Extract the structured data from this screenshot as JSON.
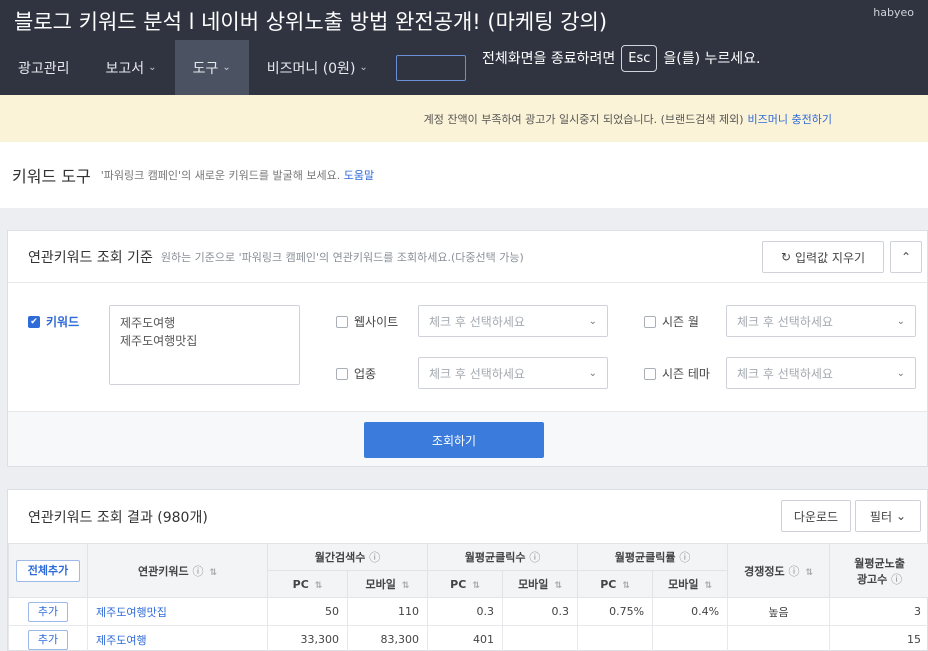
{
  "video_overlay": {
    "title": "블로그 키워드 분석 l 네이버 상위노출 방법 완전공개! (마케팅 강의)",
    "channel": "habyeo",
    "fullscreen_hint_before": "전체화면을 종료하려면",
    "fullscreen_hint_key": "Esc",
    "fullscreen_hint_after": "을(를) 누르세요."
  },
  "nav": {
    "items": [
      {
        "label": "광고관리",
        "dropdown": false,
        "active": false
      },
      {
        "label": "보고서",
        "dropdown": true,
        "active": false
      },
      {
        "label": "도구",
        "dropdown": true,
        "active": true
      },
      {
        "label": "비즈머니 (0원)",
        "dropdown": true,
        "active": false
      }
    ]
  },
  "banner": {
    "text": "계정 잔액이 부족하여 광고가 일시중지 되었습니다. (브랜드검색 제외)",
    "link": "비즈머니 충전하기"
  },
  "page_header": {
    "title": "키워드 도구",
    "desc": "'파워링크 캠페인'의 새로운 키워드를 발굴해 보세요.",
    "help": "도움말"
  },
  "criteria": {
    "title": "연관키워드 조회 기준",
    "desc": "원하는 기준으로 '파워링크 캠페인'의 연관키워드를 조회하세요.(다중선택 가능)",
    "reset_label": "입력값 지우기",
    "keyword_label": "키워드",
    "keyword_lines": [
      "제주도여행",
      "제주도여행맛집"
    ],
    "website_label": "웹사이트",
    "industry_label": "업종",
    "season_month_label": "시즌 월",
    "season_theme_label": "시즌 테마",
    "select_placeholder": "체크 후 선택하세요",
    "search_label": "조회하기"
  },
  "results": {
    "title": "연관키워드 조회 결과 (980개)",
    "download_label": "다운로드",
    "filter_label": "필터",
    "add_all_label": "전체추가",
    "headers": {
      "keyword": "연관키워드",
      "monthly_search": "월간검색수",
      "avg_clicks": "월평균클릭수",
      "avg_ctr": "월평균클릭률",
      "competition": "경쟁정도",
      "ad_count_line1": "월평균노출",
      "ad_count_line2": "광고수",
      "pc": "PC",
      "mobile": "모바일"
    },
    "rows": [
      {
        "add": "추가",
        "keyword": "제주도여행맛집",
        "search_pc": "50",
        "search_mobile": "110",
        "click_pc": "0.3",
        "click_mobile": "0.3",
        "ctr_pc": "0.75%",
        "ctr_mobile": "0.4%",
        "competition": "높음",
        "ads": "3"
      },
      {
        "add": "추가",
        "keyword": "제주도여행",
        "search_pc": "33,300",
        "search_mobile": "83,300",
        "click_pc": "401",
        "click_mobile": "",
        "ctr_pc": "",
        "ctr_mobile": "",
        "competition": "",
        "ads": "15"
      }
    ]
  }
}
